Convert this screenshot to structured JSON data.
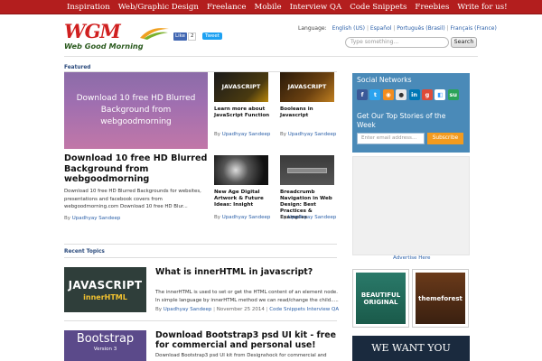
{
  "nav": {
    "items": [
      "Inspiration",
      "Web/Graphic Design",
      "Freelance",
      "Mobile",
      "Interview QA",
      "Code Snippets",
      "Freebies",
      "Write for us!"
    ]
  },
  "logo": {
    "mark": "WGM",
    "tagline": "Web Good Morning"
  },
  "social_buttons": {
    "fb_like": "Like",
    "fb_count": "2",
    "tweet": "Tweet"
  },
  "language": {
    "label": "Language:",
    "options": [
      "English (US)",
      "Español",
      "Português (Brasil)",
      "Français (France)"
    ]
  },
  "search": {
    "placeholder": "Type something...",
    "button": "Search"
  },
  "featured": {
    "heading": "Featured",
    "main": {
      "image_text": "Download 10 free HD Blurred Background from webgoodmorning",
      "title": "Download 10 free HD Blurred Background from webgoodmorning",
      "excerpt": "Download 10 free HD Blurred Backgrounds for websites, presentations and facebook covers from webgoodmorning.com Download 10 free HD Blur...",
      "by": "By",
      "author": "Upadhyay Sandeep"
    },
    "small": [
      {
        "thumb": "JAVASCRIPT",
        "title": "Learn more about JavaScript Function",
        "by": "By",
        "author": "Upadhyay Sandeep"
      },
      {
        "thumb": "JAVASCRIPT",
        "title": "Booleans in Javascript",
        "by": "By",
        "author": "Upadhyay Sandeep"
      },
      {
        "thumb": "",
        "title": "New Age Digital Artwork & Future Ideas: Insight",
        "by": "By",
        "author": "Upadhyay Sandeep"
      },
      {
        "thumb": "",
        "title": "Breadcrumb Navigation in Web Design: Best Practices & Examples",
        "by": "By",
        "author": "Upadhyay Sandeep"
      }
    ]
  },
  "recent": {
    "heading": "Recent Topics",
    "items": [
      {
        "thumb_line1": "JAVASCRIPT",
        "thumb_line2": "innerHTML",
        "title": "What is innerHTML in javascript?",
        "excerpt": "The innerHTML is used to set or get the HTML content of an element node. In simple language by innerHTML method we can read/change the child.....",
        "by": "By",
        "author": "Upadhyay Sandeep",
        "date": "November 25 2014",
        "category": "Code Snippets Interview QA"
      },
      {
        "thumb_line1": "Bootstrap",
        "thumb_line2": "Version 3",
        "title": "Download Bootstrap3 psd UI kit - free for commercial and personal use!",
        "excerpt": "Download Bootstrap3 psd UI kit from Designshock for commercial and"
      }
    ]
  },
  "sidebar": {
    "social_title": "Social Networks",
    "social_icons": [
      "facebook-icon",
      "twitter-icon",
      "rss-icon",
      "reddit-icon",
      "linkedin-icon",
      "google-plus-icon",
      "delicious-icon",
      "stumbleupon-icon"
    ],
    "newsletter_title": "Get Our Top Stories of the Week",
    "email_placeholder": "Enter email address...",
    "subscribe": "Subscribe",
    "advertise": "Advertise Here",
    "ad1_line1": "BEAUTIFUL",
    "ad1_line2": "ORIGINAL",
    "ad2_brand": "themeforest",
    "we_want": "WE WANT YOU"
  },
  "colors": {
    "nav": "#b31e1e",
    "link": "#2a5fa8",
    "sidebar": "#4a8ab8",
    "subscribe": "#f39b1f"
  }
}
